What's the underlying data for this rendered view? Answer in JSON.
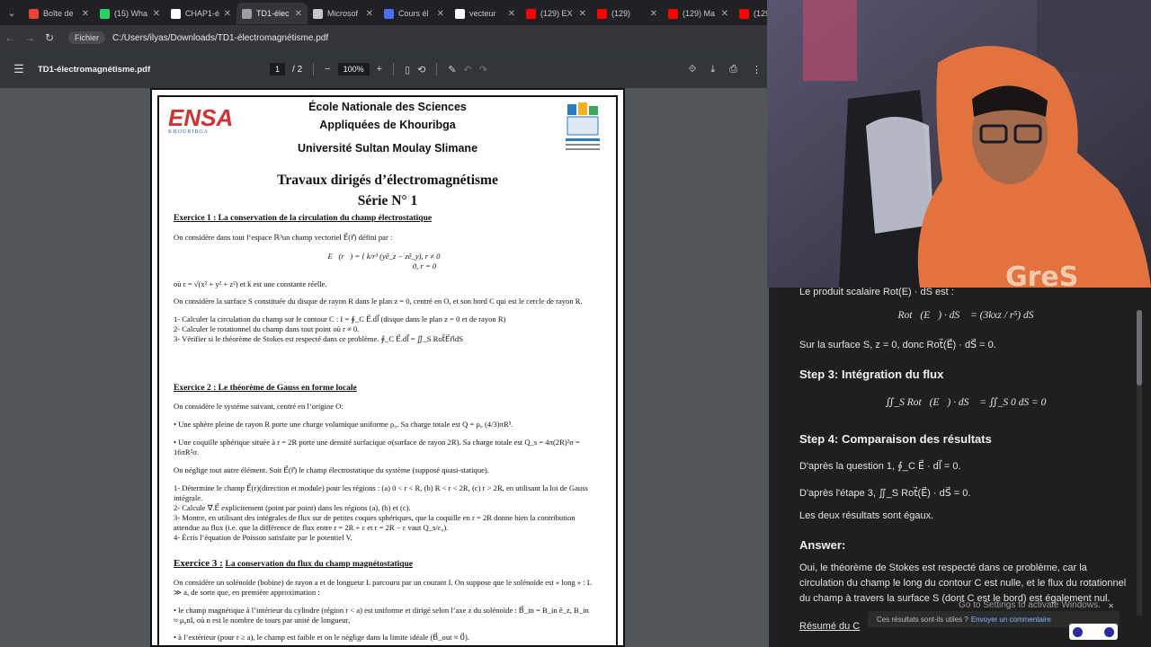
{
  "tabs": [
    {
      "label": "Boîte de",
      "color": "#ea4335"
    },
    {
      "label": "(15) Wha",
      "color": "#25d366"
    },
    {
      "label": "CHAP1-é",
      "color": "#ffffff"
    },
    {
      "label": "TD1-élec",
      "color": "#9aa0a6",
      "active": true
    },
    {
      "label": "Microsof",
      "color": "#c8c8c8"
    },
    {
      "label": "Cours él",
      "color": "#4c6fff"
    },
    {
      "label": "vecteur",
      "color": "#ffffff"
    },
    {
      "label": "(129) EX",
      "color": "#ff0000"
    },
    {
      "label": "(129)",
      "color": "#ff0000"
    },
    {
      "label": "(129) Ma",
      "color": "#ff0000"
    },
    {
      "label": "(129",
      "color": "#ff0000"
    }
  ],
  "address": {
    "chip": "Fichier",
    "url": "C:/Users/ilyas/Downloads/TD1-électromagnétisme.pdf"
  },
  "pdf_toolbar": {
    "filename": "TD1-électromagnétisme.pdf",
    "page_current": "1",
    "page_total": "/ 2",
    "zoom": "100%",
    "minus": "−",
    "plus": "+"
  },
  "document": {
    "school_line1": "École Nationale des Sciences",
    "school_line2": "Appliquées de Khouribga",
    "university": "Université Sultan Moulay Slimane",
    "logo_left": "ENSA",
    "logo_left_sub": "KHOURIBGA",
    "title": "Travaux dirigés d’électromagnétisme",
    "series": "Série N° 1",
    "ex1_title": "Exercice 1 : La conservation de la circulation du champ électrostatique",
    "ex1_intro": "On considère dans tout l’espace ℝ³un champ vectoriel E⃗(r⃗) défini par :",
    "ex1_eq1": "E⃗(r⃗) = { k/r³ (yê_z − zê_y),   r ≠ 0",
    "ex1_eq2": "0,      r = 0",
    "ex1_where": "où r = √(x² + y² + z²) et k est une constante réelle.",
    "ex1_surface": "On considère la surface S constituée du disque de rayon R dans le plan z = 0, centré en O, et son bord C qui est le cercle de rayon R.",
    "ex1_q1": "1-  Calculer la circulation du champ sur le contour C : I = ∮_C E⃗.dl⃗ (disque dans le plan z = 0 et de rayon R)",
    "ex1_q2": "2-  Calculer le rotationnel du champ dans tout point où r ≠ 0.",
    "ex1_q3": "3-  Vérifier si le théorème de Stokes est respecté dans ce problème.      ∮_C E⃗.dl⃗ = ∬_S Rot⃗E⃗n⃗dS",
    "ex2_title": "Exercice 2 : Le théorème de Gauss en forme locale",
    "ex2_intro": "On considère le système suivant, centré en l’origine O:",
    "ex2_b1": "• Une sphère pleine de rayon R porte une charge volumique uniforme ρ₀. Sa charge totale est Q = ρ₀ (4/3)πR³.",
    "ex2_b2": "•  Une coquille sphérique située à r = 2R porte une densité surfacique σ(surface de rayon 2R). Sa charge totale est Q_s = 4π(2R)²σ = 16πR²σ.",
    "ex2_neglect": "On néglige tout autre élément. Soit E⃗(r⃗) le champ électrostatique du système (supposé quasi-statique).",
    "ex2_q1": "1-    Détermine le champ E⃗(r)(direction et module) pour les régions : (a) 0 < r < R, (b) R < r < 2R, (c) r > 2R, en utilisant la loi de Gauss intégrale.",
    "ex2_q2": "2-    Calcule ∇⃗.E⃗ explicitement (point par point) dans les régions (a), (b) et (c).",
    "ex2_q3": "3-    Montre, en utilisant des intégrales de flux sur de petites coques sphériques, que la coquille en r = 2R donne bien la contribution attendue au flux (i.e. que la différence de flux entre r = 2R + ε et r = 2R − ε vaut Q_s/ε₀).",
    "ex2_q4": "4-    Écris l’équation de Poisson satisfaite par le potentiel V.",
    "ex3_title_a": "Exercice 3 :",
    "ex3_title_b": "La conservation du flux du champ magnétostatique",
    "ex3_intro": "On considère un solénoïde (bobine) de rayon a et de longueur L parcouru par un courant I. On suppose que le solénoïde est « long » : L ≫ a, de sorte que, en première approximation :",
    "ex3_b1": "•   le champ magnétique à l’intérieur du cylindre (région r < a) est uniforme et dirigé selon l’axe z du solénoïde : B⃗_in = B_in ê_z, B_in ≈ μ₀nI, où n est le nombre de tours par unité de longueur,",
    "ex3_b2": "•   à l’extérieur (pour r ≥ a), le champ est faible et on le néglige dans la limite idéale (B⃗_out ≈ 0⃗)."
  },
  "ai_panel": {
    "line_product": "Le produit scalaire Rot(E) · dS est :",
    "eq_product": "Rot⃗(E⃗) · dS⃗ = (3kxz / r⁵) dS",
    "line_surface": "Sur la surface S, z = 0, donc Rot⃗(E⃗) · dS⃗ = 0.",
    "step3": "Step 3: Intégration du flux",
    "eq_flux": "∬_S Rot⃗(E⃗) · dS⃗ = ∬_S 0 dS = 0",
    "step4": "Step 4: Comparaison des résultats",
    "line_q1": "D'après la question 1,  ∮_C E⃗ · dl⃗ = 0.",
    "line_e3": "D'après l'étape 3,  ∬_S Rot⃗(E⃗) · dS⃗ = 0.",
    "line_equal": "Les deux résultats sont égaux.",
    "answer_h": "Answer:",
    "answer_text": "Oui, le théorème de Stokes est respecté dans ce problème, car la circulation du champ le long du contour C est nulle, et le flux du rotationnel du champ à travers la surface S (dont C est le bord) est également nul.",
    "summary_link": "Résumé du C",
    "feedback_q": "Ces résultats sont-ils utiles ?",
    "feedback_link": "Envoyer un commentaire",
    "watermark": "Go to Settings to activate Windows."
  },
  "webcam": {
    "hoodie_text": "GreS"
  }
}
